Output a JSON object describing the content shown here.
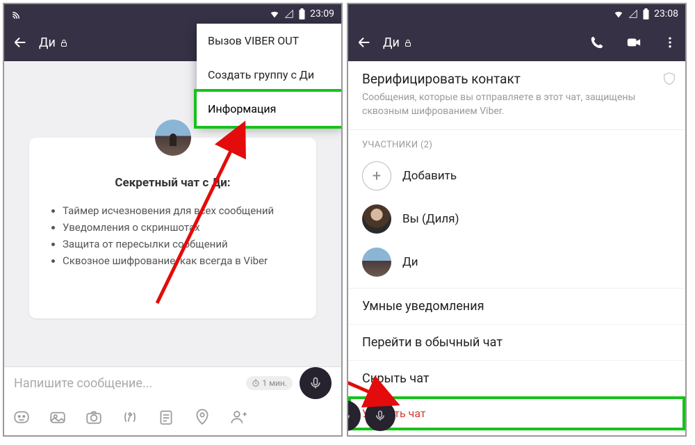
{
  "left": {
    "status": {
      "time": "23:09"
    },
    "appbar": {
      "title": "Ди"
    },
    "dropdown": {
      "item1": "Вызов VIBER OUT",
      "item2": "Создать группу с Ди",
      "item3": "Информация"
    },
    "card": {
      "title": "Секретный чат с Ди:",
      "b1": "Таймер исчезновения для всех сообщений",
      "b2": "Уведомления о скриншотах",
      "b3": "Защита от пересылки сообщений",
      "b4": "Сквозное шифрование, как всегда в Viber"
    },
    "composer": {
      "placeholder": "Напишите сообщение...",
      "timer": "1 мин."
    }
  },
  "right": {
    "status": {
      "time": "23:08"
    },
    "appbar": {
      "title": "Ди"
    },
    "verify": {
      "title": "Верифицировать контакт",
      "sub": "Сообщения, которые вы отправляете в этот чат, защищены сквозным шифрованием Viber."
    },
    "participants": {
      "label": "УЧАСТНИКИ (2)",
      "add": "Добавить",
      "p1": "Вы (Диля)",
      "p2": "Ди"
    },
    "settings": {
      "smart": "Умные уведомления",
      "regular": "Перейти в обычный чат",
      "hide": "Скрыть чат",
      "delete": "Удалить чат"
    }
  }
}
